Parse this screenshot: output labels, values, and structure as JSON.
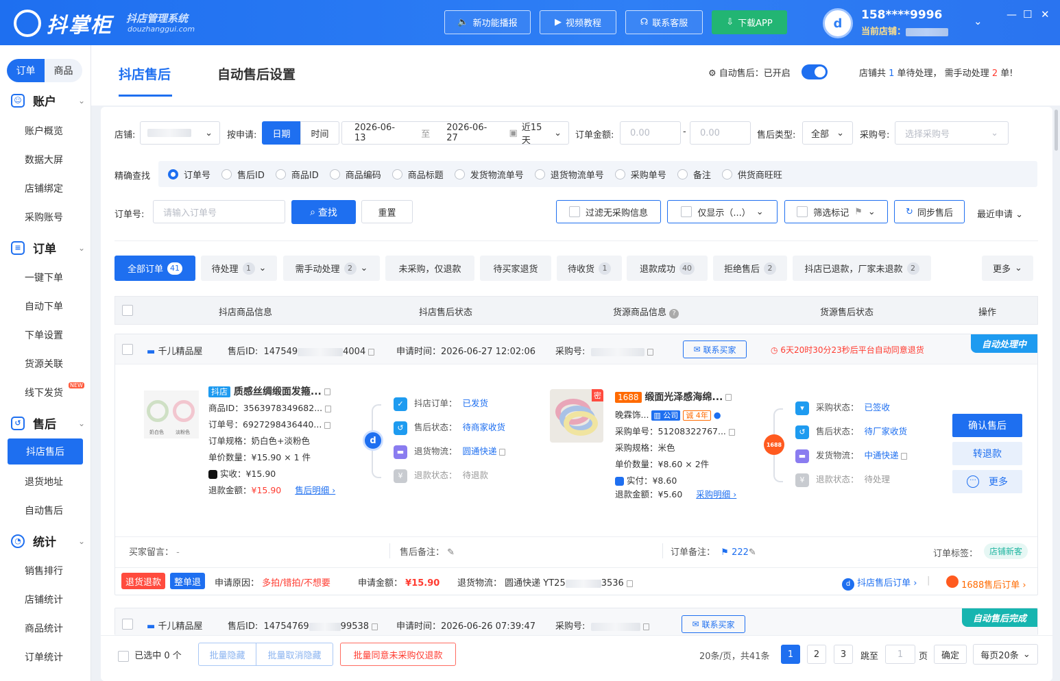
{
  "app": {
    "name": "抖掌柜",
    "subtitle": "抖店管理系统",
    "domain": "douzhanggui.com"
  },
  "topbar": {
    "buttons": [
      "新功能播报",
      "视频教程",
      "联系客服",
      "下载APP"
    ],
    "phone": "158****9996",
    "store_label": "当前店铺："
  },
  "sidebar": {
    "switch": [
      "订单",
      "商品"
    ],
    "groups": [
      {
        "title": "账户",
        "items": [
          "账户概览",
          "数据大屏",
          "店铺绑定",
          "采购账号"
        ]
      },
      {
        "title": "订单",
        "items": [
          "一键下单",
          "自动下单",
          "下单设置",
          "货源关联",
          "线下发货"
        ]
      },
      {
        "title": "售后",
        "items": [
          "抖店售后",
          "退货地址",
          "自动售后"
        ]
      },
      {
        "title": "统计",
        "items": [
          "销售排行",
          "店铺统计",
          "商品统计",
          "订单统计"
        ]
      }
    ],
    "new_tag": "NEW"
  },
  "tabs": {
    "active": "抖店售后",
    "other": "自动售后设置"
  },
  "auto": {
    "label": "自动售后：已开启",
    "pending_pre": "店铺共 ",
    "pending_n1": "1",
    "pending_mid": " 单待处理， 需手动处理 ",
    "pending_n2": "2",
    "pending_post": " 单!"
  },
  "filters": {
    "store_label": "店铺:",
    "apply_label": "按申请:",
    "date_btn": "日期",
    "time_btn": "时间",
    "date_from": "2026-06-13",
    "date_to_sep": "至",
    "date_to": "2026-06-27",
    "range": "近15天",
    "amount_label": "订单金额:",
    "amount_min": "0.00",
    "amount_sep": "-",
    "amount_max": "0.00",
    "type_label": "售后类型:",
    "type_value": "全部",
    "purchase_label": "采购号:",
    "purchase_ph": "选择采购号",
    "precise_label": "精确查找",
    "radios": [
      "订单号",
      "售后ID",
      "商品ID",
      "商品编码",
      "商品标题",
      "发货物流单号",
      "退货物流单号",
      "采购单号",
      "备注",
      "供货商旺旺"
    ],
    "order_label": "订单号:",
    "order_ph": "请输入订单号",
    "search_btn": "查找",
    "reset_btn": "重置",
    "filter_no_purchase": "过滤无采购信息",
    "only_show": "仅显示（...）",
    "mark_filter": "筛选标记",
    "sync": "同步售后",
    "sort": "最近申请"
  },
  "status_tabs": [
    {
      "label": "全部订单",
      "count": "41"
    },
    {
      "label": "待处理",
      "count": "1"
    },
    {
      "label": "需手动处理",
      "count": "2"
    },
    {
      "label": "未采购，仅退款",
      "count": ""
    },
    {
      "label": "待买家退货",
      "count": ""
    },
    {
      "label": "待收货",
      "count": "1"
    },
    {
      "label": "退款成功",
      "count": "40"
    },
    {
      "label": "拒绝售后",
      "count": "2"
    },
    {
      "label": "抖店已退款，厂家未退款",
      "count": "2"
    },
    {
      "label": "更多",
      "count": ""
    }
  ],
  "table_headers": [
    "抖店商品信息",
    "抖店售后状态",
    "货源商品信息",
    "货源售后状态",
    "操作"
  ],
  "order1": {
    "shop": "千儿精品屋",
    "after_id_label": "售后ID:",
    "after_id_pre": "147549",
    "after_id_post": "4004",
    "apply_time": "申请时间：2026-06-27 12:02:06",
    "purchase_no_label": "采购号:",
    "contact": "联系买家",
    "countdown": "6天20时30分23秒后平台自动同意退货",
    "badge": "自动处理中",
    "platform_tag": "抖店",
    "title": "质感丝绸缎面发箍...",
    "product_id": "商品ID：3563978349682...",
    "order_no": "订单号：6927298436440...",
    "spec": "订单规格：奶白色+淡粉色",
    "price_qty": "单价数量：¥15.90 × 1 件",
    "paid": "实收：¥15.90",
    "refund_label": "退款金额：",
    "refund_amount": "¥15.90",
    "refund_detail": "售后明细 ›",
    "img_cap1": "奶白色",
    "img_cap2": "淡粉色",
    "dy_status": [
      {
        "k": "抖店订单：",
        "v": "已发货"
      },
      {
        "k": "售后状态：",
        "v": "待商家收货"
      },
      {
        "k": "退货物流：",
        "v": "圆通快递"
      },
      {
        "k": "退款状态：",
        "v": "待退款"
      }
    ],
    "src_tag": "1688",
    "src_title": "缎面光泽感海绵...",
    "src_shop": "晚霖饰...",
    "src_company": "公司",
    "src_years": "诚 4年",
    "src_secret": "密",
    "src_po": "采购单号：51208322767...",
    "src_spec": "采购规格：米色",
    "src_price": "单价数量：¥8.60 × 2件",
    "src_paid": "实付：¥8.60",
    "src_refund": "退款金额：¥5.60",
    "src_detail": "采购明细 ›",
    "src_status": [
      {
        "k": "采购状态：",
        "v": "已签收"
      },
      {
        "k": "售后状态：",
        "v": "待厂家收货"
      },
      {
        "k": "发货物流：",
        "v": "中通快递"
      },
      {
        "k": "退款状态：",
        "v": "待处理"
      }
    ],
    "actions": [
      "确认售后",
      "转退款",
      "更多"
    ],
    "buyer_msg": "买家留言：",
    "buyer_msg_val": "-",
    "after_note": "售后备注：",
    "order_note": "订单备注：",
    "order_note_val": "222",
    "order_tag_label": "订单标签：",
    "order_tag": "店铺新客",
    "tag_refund": "退货退款",
    "tag_whole": "整单退",
    "reason_label": "申请原因：",
    "reason": "多拍/错拍/不想要",
    "amount_label": "申请金额：",
    "amount": "¥15.90",
    "return_label": "退货物流：",
    "return_pre": "圆通快递 YT25",
    "return_post": "3536",
    "link_dy": "抖店售后订单 ›",
    "link_1688": "1688售后订单 ›"
  },
  "order2": {
    "shop": "千儿精品屋",
    "after_id_label": "售后ID:",
    "after_id_pre": "14754769",
    "after_id_post": "99538",
    "apply_time": "申请时间：2026-06-26 07:39:47",
    "purchase_no_label": "采购号:",
    "contact": "联系买家",
    "badge": "自动售后完成"
  },
  "footer": {
    "selected": "已选中 0 个",
    "batch_hide": "批量隐藏",
    "batch_unhide": "批量取消隐藏",
    "batch_agree": "批量同意未采购仅退款",
    "per_page_info": "20条/页，共41条",
    "pages": [
      "1",
      "2",
      "3"
    ],
    "goto": "跳至",
    "goto_val": "1",
    "page_unit": "页",
    "confirm": "确定",
    "per_page": "每页20条"
  }
}
